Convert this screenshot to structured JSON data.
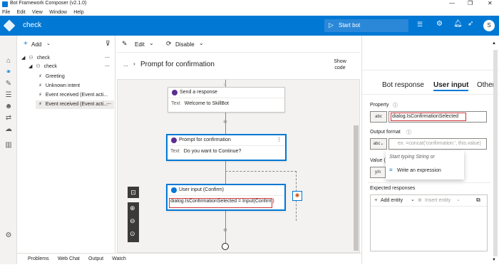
{
  "app": {
    "window_title": "Bot Framework Composer (v2.1.0)",
    "menu": [
      "File",
      "Edit",
      "View",
      "Window",
      "Help"
    ],
    "bot_name": "check",
    "start_bot": "Start bot",
    "avatar": "S"
  },
  "tree": {
    "add_label": "Add",
    "items": [
      {
        "label": "check"
      },
      {
        "label": "check"
      },
      {
        "label": "Greeting"
      },
      {
        "label": "Unknown intent"
      },
      {
        "label": "Event received (Event acti..."
      },
      {
        "label": "Event received (Event acti..."
      }
    ]
  },
  "toolbar": {
    "edit_label": "Edit",
    "disable_label": "Disable"
  },
  "breadcrumb": {
    "ellipsis": "...",
    "title": "Prompt for confirmation",
    "show_code": "Show code"
  },
  "canvas": {
    "send_response": {
      "title": "Send a response",
      "key": "Text",
      "value": "Welcome to SkillBot"
    },
    "prompt": {
      "title": "Prompt for confirmation",
      "key": "Text",
      "value": "Do you want to Continue?"
    },
    "user_input": {
      "title": "User input (Confirm)",
      "value": "dialog.IsConfirmationSelected = Input(Confirm)"
    }
  },
  "right_panel": {
    "tabs": [
      "Bot response",
      "User input",
      "Other"
    ],
    "active_tab": "User input",
    "property_label": "Property",
    "property_type": "abc",
    "property_value": "dialog.IsConfirmationSelected",
    "output_format_label": "Output format",
    "output_format_type": "abc",
    "output_format_placeholder": "ex. =concat('confirmation:', this.value)",
    "dropdown_hint": "Start typing String or",
    "dropdown_option": "Write an expression",
    "value_label": "Value (",
    "value_type": "y/n",
    "expected_label": "Expected responses",
    "add_entity": "Add entity",
    "insert_entity": "Insert entity"
  },
  "bottom": {
    "tabs": [
      "Problems",
      "Web Chat",
      "Output",
      "Watch"
    ]
  },
  "colors": {
    "accent": "#0078d4",
    "highlight": "#d13438",
    "node_purple": "#5c2e91"
  }
}
